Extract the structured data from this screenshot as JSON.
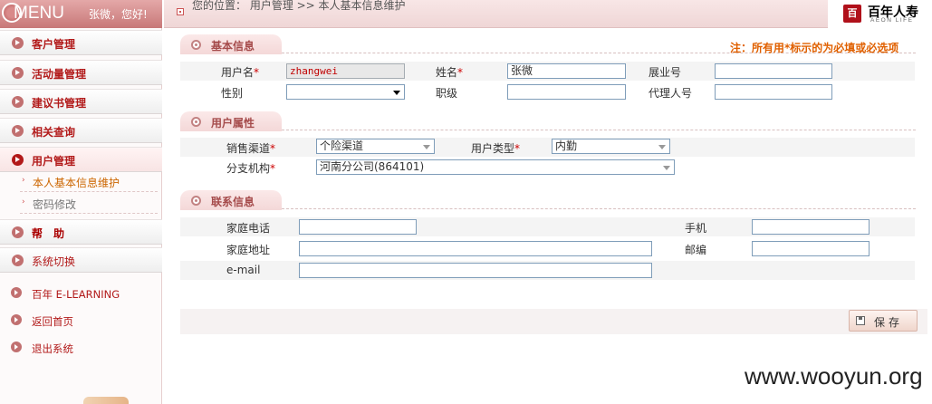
{
  "menu": {
    "title": "MENU",
    "greeting": "张微，您好!"
  },
  "sidebar": {
    "items": [
      {
        "label": "客户管理"
      },
      {
        "label": "活动量管理"
      },
      {
        "label": "建议书管理"
      },
      {
        "label": "相关查询"
      },
      {
        "label": "用户管理"
      }
    ],
    "sub_items": [
      {
        "label": "本人基本信息维护"
      },
      {
        "label": "密码修改"
      }
    ],
    "help": {
      "label": "帮　助"
    },
    "switch": {
      "label": "系统切换"
    },
    "links": [
      {
        "label": "百年 E-LEARNING"
      },
      {
        "label": "返回首页"
      },
      {
        "label": "退出系统"
      }
    ]
  },
  "topbar": {
    "breadcrumb": "您的位置：  用户管理  >> 本人基本信息维护",
    "brand_cn": "百年人寿",
    "brand_en": "AEON LIFE",
    "brand_mark": "百"
  },
  "notice": "注：所有用*标示的为必填或必选项",
  "sections": {
    "basic": "基本信息",
    "attributes": "用户属性",
    "contact": "联系信息"
  },
  "basic": {
    "username_label": "用户名",
    "username_value": "zhangwei",
    "name_label": "姓名",
    "name_value": "张微",
    "exhibition_no_label": "展业号",
    "exhibition_no_value": "",
    "gender_label": "性别",
    "gender_value": "",
    "rank_label": "职级",
    "rank_value": "",
    "agent_no_label": "代理人号",
    "agent_no_value": "",
    "required_mark": "*"
  },
  "attributes": {
    "channel_label": "销售渠道",
    "channel_value": "个险渠道",
    "user_type_label": "用户类型",
    "user_type_value": "内勤",
    "branch_label": "分支机构",
    "branch_value": "河南分公司(864101)"
  },
  "contact": {
    "home_phone_label": "家庭电话",
    "home_phone_value": "",
    "mobile_label": "手机",
    "mobile_value": "",
    "home_address_label": "家庭地址",
    "home_address_value": "",
    "postcode_label": "邮编",
    "postcode_value": "",
    "email_label": "e-mail",
    "email_value": ""
  },
  "actions": {
    "save_label": "保存"
  },
  "watermark": "www.wooyun.org",
  "colors": {
    "accent_red": "#b21a1a",
    "notice_orange": "#e06000",
    "header_pink": "#efd6d6"
  }
}
